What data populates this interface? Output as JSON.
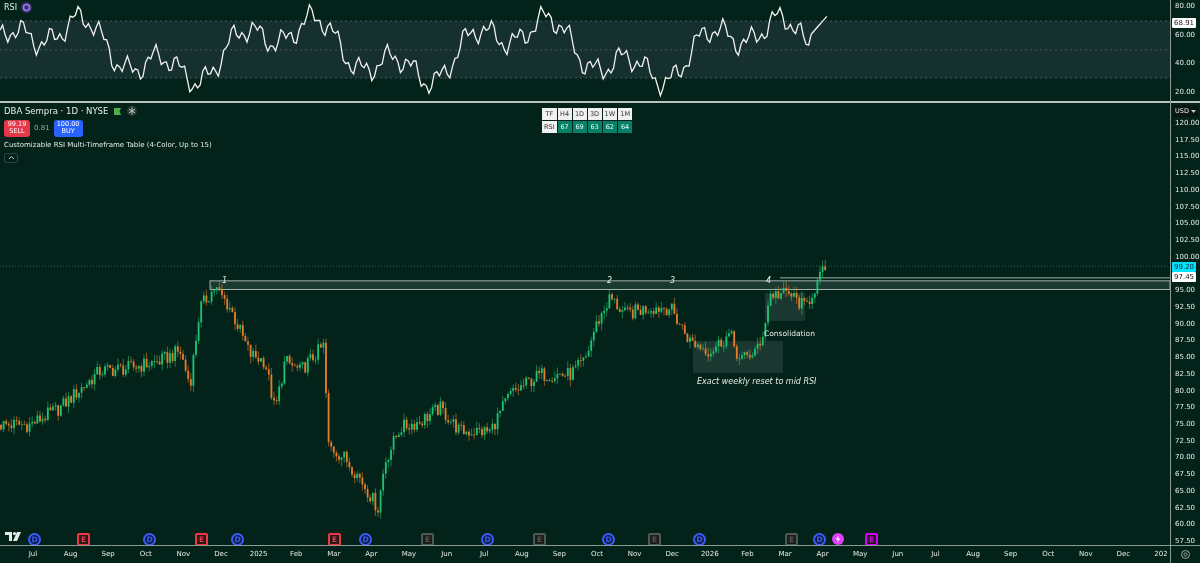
{
  "rsi_pane": {
    "title": "RSI",
    "axis_labels": [
      "80.00",
      "60.00",
      "40.00",
      "20.00"
    ],
    "current_value": "68.91"
  },
  "symbol": {
    "title": "DBA Sempra · 1D · NYSE"
  },
  "trade": {
    "sell_price": "99.19",
    "sell_label": "SELL",
    "spread": "0.81",
    "buy_price": "100.00",
    "buy_label": "BUY"
  },
  "indicator": {
    "name": "Customizable RSI Multi-Timeframe Table (4-Color, Up to 15)"
  },
  "rsi_table": {
    "header": [
      "TF",
      "H4",
      "1D",
      "3D",
      "1W",
      "1M"
    ],
    "row": [
      "RSI",
      "67",
      "69",
      "63",
      "62",
      "64"
    ]
  },
  "price_axis": {
    "currency": "USD",
    "labels_upper": [
      "120.00",
      "117.50",
      "115.00",
      "112.50",
      "110.00",
      "107.50",
      "105.00",
      "102.50",
      "100.00"
    ],
    "last_price": "99.20",
    "level_price": "97.45",
    "labels_lower": [
      "95.00",
      "92.50",
      "90.00",
      "87.50",
      "85.00",
      "82.50",
      "80.00",
      "77.50",
      "75.00",
      "72.50",
      "70.00",
      "67.50",
      "65.00",
      "62.50",
      "60.00",
      "57.50"
    ]
  },
  "annotations": {
    "peaks": [
      "1",
      "2",
      "3",
      "4"
    ],
    "consolidation": "Consolidation",
    "reset_note": "Exact weekly reset to mid RSI"
  },
  "events": [
    {
      "kind": "dividend",
      "label": "D",
      "color": "#3d5afe"
    },
    {
      "kind": "earnings",
      "label": "E",
      "color": "#f23645"
    },
    {
      "kind": "dividend",
      "label": "D",
      "color": "#3d5afe"
    },
    {
      "kind": "earnings",
      "label": "E",
      "color": "#f23645"
    },
    {
      "kind": "dividend",
      "label": "D",
      "color": "#3d5afe"
    },
    {
      "kind": "earnings",
      "label": "E",
      "color": "#f23645"
    },
    {
      "kind": "dividend",
      "label": "D",
      "color": "#3d5afe"
    },
    {
      "kind": "earnings",
      "label": "E",
      "color": "#4a5a55"
    },
    {
      "kind": "dividend",
      "label": "D",
      "color": "#3d5afe"
    },
    {
      "kind": "earnings",
      "label": "E",
      "color": "#4a5a55"
    },
    {
      "kind": "dividend",
      "label": "D",
      "color": "#3d5afe"
    },
    {
      "kind": "earnings",
      "label": "E",
      "color": "#4a5a55"
    },
    {
      "kind": "dividend",
      "label": "D",
      "color": "#3d5afe"
    },
    {
      "kind": "earnings",
      "label": "E",
      "color": "#4a5a55"
    },
    {
      "kind": "dividend",
      "label": "D",
      "color": "#3d5afe"
    },
    {
      "kind": "split",
      "color": "#e040fb"
    },
    {
      "kind": "earnings",
      "label": "E",
      "color": "#d500f9"
    }
  ],
  "time_axis": {
    "labels": [
      "Jul",
      "Aug",
      "Sep",
      "Oct",
      "Nov",
      "Dec",
      "2025",
      "Feb",
      "Mar",
      "Apr",
      "May",
      "Jun",
      "Jul",
      "Aug",
      "Sep",
      "Oct",
      "Nov",
      "Dec",
      "2026",
      "Feb",
      "Mar",
      "Apr",
      "May",
      "Jun",
      "Jul",
      "Aug",
      "Sep",
      "Oct",
      "Nov",
      "Dec",
      "202"
    ]
  }
}
